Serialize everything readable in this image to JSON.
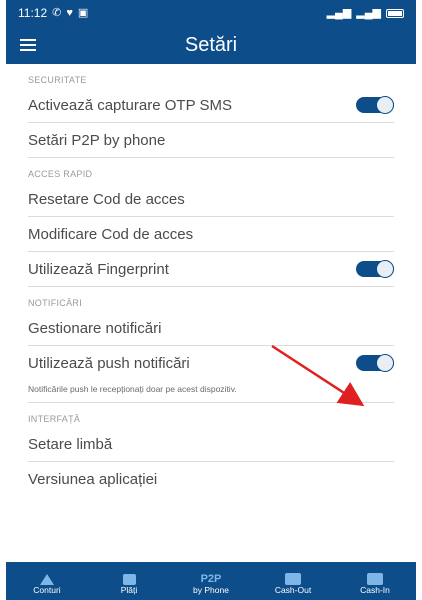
{
  "statusbar": {
    "time": "11:12",
    "left_icons": [
      "whatsapp-icon",
      "heart-icon",
      "gallery-icon"
    ],
    "right_icons": [
      "signal-icon",
      "signal-icon",
      "battery-icon"
    ]
  },
  "appbar": {
    "title": "Setări"
  },
  "sections": {
    "security": {
      "header": "SECURITATE",
      "otp_label": "Activează capturare OTP SMS",
      "otp_toggle_on": true,
      "p2p_label": "Setări P2P by phone"
    },
    "quick_access": {
      "header": "ACCES RAPID",
      "reset_label": "Resetare Cod de acces",
      "modify_label": "Modificare Cod de acces",
      "fingerprint_label": "Utilizează Fingerprint",
      "fingerprint_toggle_on": true
    },
    "notifications": {
      "header": "NOTIFICĂRI",
      "manage_label": "Gestionare notificări",
      "push_label": "Utilizează push notificări",
      "push_toggle_on": true,
      "note": "Notificările push le recepționați doar pe acest dispozitiv."
    },
    "interface": {
      "header": "INTERFAȚĂ",
      "language_label": "Setare limbă",
      "version_label": "Versiunea aplicației"
    }
  },
  "bottom_nav": [
    {
      "label": "Conturi",
      "icon": "house-icon"
    },
    {
      "label": "Plăți",
      "icon": "wallet-icon"
    },
    {
      "label": "by Phone",
      "icon_text": "P2P"
    },
    {
      "label": "Cash-Out",
      "icon": "atm-icon"
    },
    {
      "label": "Cash-In",
      "icon": "atm-icon"
    }
  ],
  "colors": {
    "primary": "#0d4d8a",
    "annotation_arrow": "#e02020",
    "section_header": "#9a9a9a",
    "row_text": "#4b4b4b"
  }
}
